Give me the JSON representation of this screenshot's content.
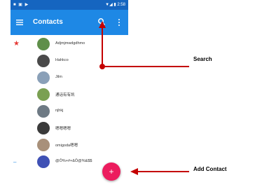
{
  "status_bar": {
    "left_icons": "■ ▣ ▶",
    "right_text": "▼◢ ▮ 2:58"
  },
  "app_bar": {
    "title": "Contacts"
  },
  "contacts": [
    {
      "name": "Adjmjmwdgdhmo",
      "starred": true,
      "avatar_color": "#5f8f4a"
    },
    {
      "name": "Hahkco",
      "starred": false,
      "avatar_color": "#4a4a4a"
    },
    {
      "name": "Jilm",
      "starred": false,
      "avatar_color": "#8aa0b8"
    },
    {
      "name": "通话有有凯",
      "starred": false,
      "avatar_color": "#7aa052"
    },
    {
      "name": "njhkj",
      "starred": false,
      "avatar_color": "#6e7a84"
    },
    {
      "name": "嗯嗯嗯嗯",
      "starred": false,
      "avatar_color": "#3a3a3a"
    },
    {
      "name": "omigoda嗯嗯",
      "starred": false,
      "avatar_color": "#a8907a"
    },
    {
      "name": "@Ô%+#+&Ô@%&$$",
      "starred": false,
      "avatar_color": "#3f51b5",
      "dash": "–"
    }
  ],
  "fab": {
    "label": "+"
  },
  "annotations": {
    "search": "Search",
    "add_contact": "Add Contact",
    "color": "#c40000"
  },
  "colors": {
    "status_bar": "#1565c0",
    "app_bar": "#1e88e5",
    "fab": "#ec1c5e",
    "star": "#e53935"
  }
}
